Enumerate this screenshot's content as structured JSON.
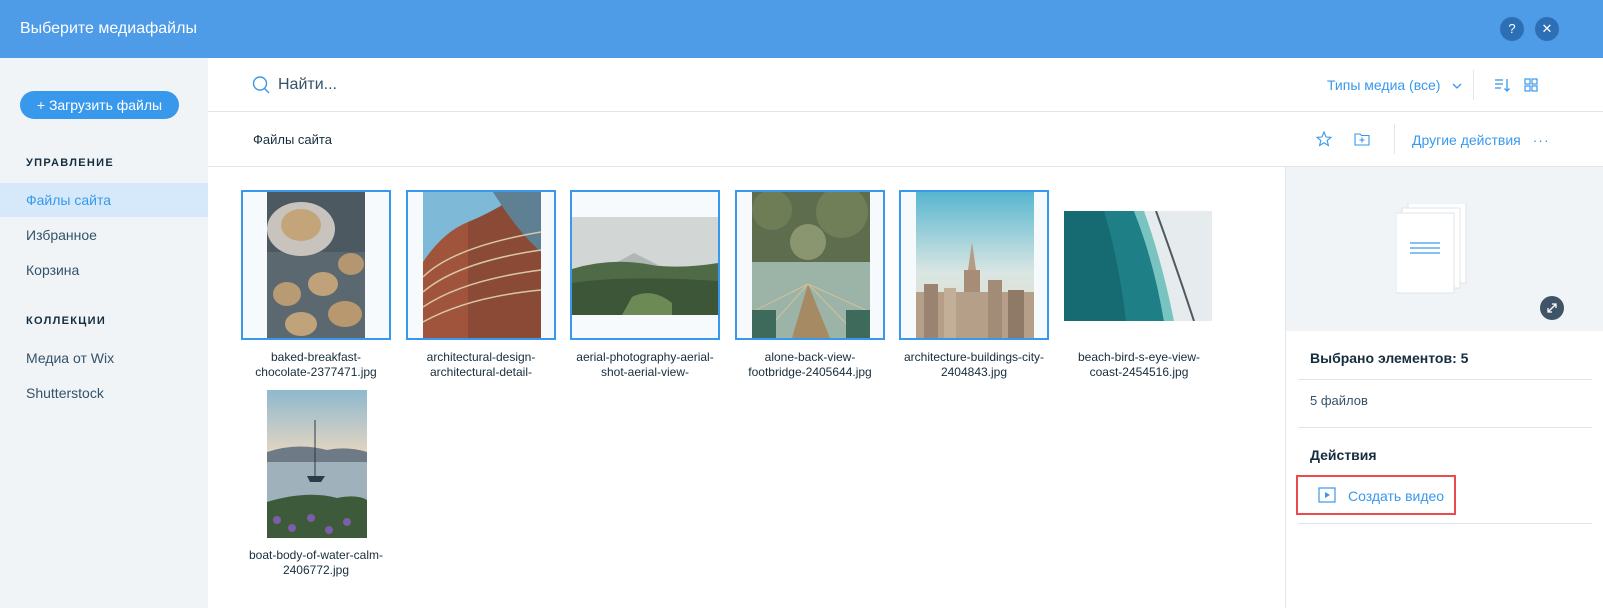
{
  "header": {
    "title": "Выберите медиафайлы",
    "help_label": "?",
    "close_label": "✕"
  },
  "sidebar": {
    "upload_label": "+ Загрузить файлы",
    "manage_heading": "УПРАВЛЕНИЕ",
    "manage_items": [
      {
        "label": "Файлы сайта",
        "active": true
      },
      {
        "label": "Избранное",
        "active": false
      },
      {
        "label": "Корзина",
        "active": false
      }
    ],
    "collections_heading": "КОЛЛЕКЦИИ",
    "collection_items": [
      {
        "label": "Медиа от Wix"
      },
      {
        "label": "Shutterstock"
      }
    ]
  },
  "search": {
    "placeholder": "Найти...",
    "value": ""
  },
  "toolbar": {
    "media_types_label": "Типы медиа (все)",
    "sort_icon": "sort-icon",
    "grid_icon": "grid-view-icon"
  },
  "path": {
    "label": "Файлы сайта",
    "more_actions_label": "Другие действия",
    "more_icon": "···"
  },
  "files": [
    {
      "name": "baked-breakfast-chocolate-2377471.jpg",
      "line1": "baked-breakfast-",
      "line2": "chocolate-2377471.jpg",
      "selected": true
    },
    {
      "name": "architectural-design-architectural-detail-",
      "line1": "architectural-design-",
      "line2": "architectural-detail-",
      "selected": true
    },
    {
      "name": "aerial-photography-aerial-shot-aerial-view-",
      "line1": "aerial-photography-aerial-",
      "line2": "shot-aerial-view-",
      "selected": true
    },
    {
      "name": "alone-back-view-footbridge-2405644.jpg",
      "line1": "alone-back-view-",
      "line2": "footbridge-2405644.jpg",
      "selected": true
    },
    {
      "name": "architecture-buildings-city-2404843.jpg",
      "line1": "architecture-buildings-city-",
      "line2": "2404843.jpg",
      "selected": true
    },
    {
      "name": "beach-bird-s-eye-view-coast-2454516.jpg",
      "line1": "beach-bird-s-eye-view-",
      "line2": "coast-2454516.jpg",
      "selected": false
    },
    {
      "name": "boat-body-of-water-calm-2406772.jpg",
      "line1": "boat-body-of-water-calm-",
      "line2": "2406772.jpg",
      "selected": false
    }
  ],
  "details": {
    "selected_label": "Выбрано элементов: 5",
    "files_count_label": "5 файлов",
    "actions_heading": "Действия",
    "create_video_label": "Создать видео"
  },
  "colors": {
    "header": "#4e9be8",
    "accent": "#3899ec",
    "highlight_box": "#e84c4c"
  }
}
